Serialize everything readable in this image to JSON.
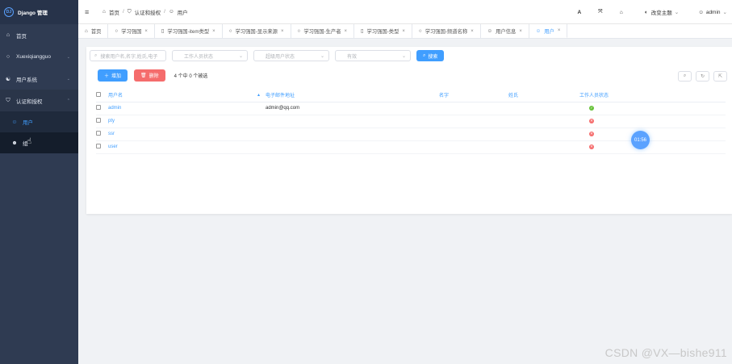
{
  "brand": {
    "title": "Django 管理",
    "logo_text": "DJ"
  },
  "sidebar": {
    "items": [
      {
        "label": "首页",
        "icon": "home-icon"
      },
      {
        "label": "Xuexiqiangguo",
        "icon": "circle-icon"
      },
      {
        "label": "用户系统",
        "icon": "user-icon"
      },
      {
        "label": "认证和授权",
        "icon": "shield-icon"
      }
    ],
    "sub_items": [
      {
        "label": "用户",
        "icon": "user-icon"
      },
      {
        "label": "组",
        "icon": "group-icon"
      }
    ]
  },
  "header": {
    "breadcrumb": [
      "首页",
      "认证和授权",
      "用户"
    ],
    "theme_label": "改变主题",
    "user_label": "admin"
  },
  "tabs": [
    {
      "label": "首页"
    },
    {
      "label": "学习强国"
    },
    {
      "label": "学习强国-item类型"
    },
    {
      "label": "学习强国-显示来源"
    },
    {
      "label": "学习强国-生产者"
    },
    {
      "label": "学习强国-类型"
    },
    {
      "label": "学习强国-频道名称"
    },
    {
      "label": "用户信息"
    },
    {
      "label": "用户"
    }
  ],
  "filters": {
    "search_placeholder": "搜索用户名,名字,姓氏,电子",
    "staff_status": "工作人员状态",
    "superuser_status": "超级用户状态",
    "active_status": "有效",
    "search_button": "搜索"
  },
  "toolbar": {
    "add_label": "增加",
    "delete_label": "删除",
    "selected_info": "4 个中 0 个被选"
  },
  "table": {
    "headers": [
      "用户名",
      "电子邮件地址",
      "名字",
      "姓氏",
      "工作人员状态"
    ],
    "rows": [
      {
        "username": "admin",
        "email": "admin@qq.com",
        "first_name": "",
        "last_name": "",
        "is_staff": true
      },
      {
        "username": "pty",
        "email": "",
        "first_name": "",
        "last_name": "",
        "is_staff": false
      },
      {
        "username": "ssr",
        "email": "",
        "first_name": "",
        "last_name": "",
        "is_staff": false
      },
      {
        "username": "user",
        "email": "",
        "first_name": "",
        "last_name": "",
        "is_staff": false
      }
    ]
  },
  "timer": "01:56",
  "watermark": "CSDN @VX—bishe911",
  "colors": {
    "sidebar": "#2f3b52",
    "accent": "#409eff",
    "danger": "#f56c6c",
    "success": "#67c23a"
  }
}
